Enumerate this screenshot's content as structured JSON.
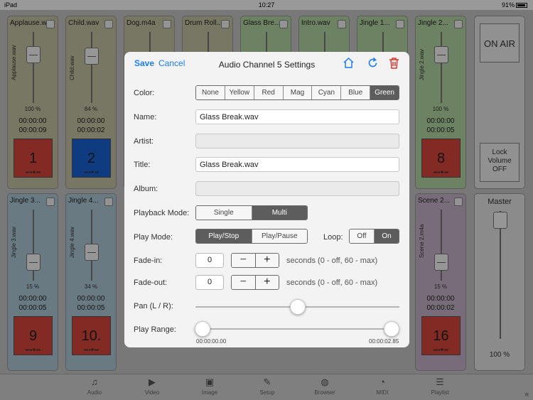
{
  "status": {
    "device": "iPad",
    "time": "10:27",
    "battery": "91%"
  },
  "channels_top": [
    {
      "name": "Applause.wav",
      "vname": "Applause.wav",
      "pct": "100 %",
      "t1": "00:00:00",
      "t2": "00:00:09",
      "num": "1",
      "color": "#d9473b",
      "bg": "#c9c7a5"
    },
    {
      "name": "Child.wav",
      "vname": "Child.wav",
      "pct": "84 %",
      "t1": "00:00:00",
      "t2": "00:00:02",
      "num": "2",
      "color": "#1a63d6",
      "bg": "#c9c7a5"
    },
    {
      "name": "Dog.m4a",
      "bg": "#c9c7a5"
    },
    {
      "name": "Drum Roll...",
      "bg": "#c9c7a5"
    },
    {
      "name": "Glass Bre...",
      "bg": "#b5d9a6"
    },
    {
      "name": "Intro.wav",
      "bg": "#b5d9a6"
    },
    {
      "name": "Jingle 1...",
      "bg": "#b5d9a6"
    },
    {
      "name": "Jingle 2...",
      "vname": "Jingle 2.wav",
      "pct": "100 %",
      "t1": "00:00:00",
      "t2": "00:00:05",
      "num": "8",
      "color": "#d9473b",
      "bg": "#b5d9a6"
    }
  ],
  "channels_bottom": [
    {
      "name": "Jingle 3...",
      "vname": "Jingle 3.wav",
      "pct": "15 %",
      "t1": "00:00:00",
      "t2": "00:00:05",
      "num": "9",
      "color": "#d9473b",
      "bg": "#b0ccd9"
    },
    {
      "name": "Jingle 4...",
      "vname": "Jingle 4.wav",
      "pct": "34 %",
      "t1": "00:00:00",
      "t2": "00:00:05",
      "num": "10.",
      "color": "#d9473b",
      "bg": "#b0ccd9"
    },
    {
      "name": "Scene 2...",
      "vname": "Scene 2.m4a",
      "pct": "15 %",
      "t1": "00:00:00",
      "t2": "00:00:02",
      "num": "16",
      "color": "#d9473b",
      "bg": "#c9b3cc"
    }
  ],
  "side": {
    "on_air": "ON AIR",
    "lock_l1": "Lock",
    "lock_l2": "Volume",
    "lock_l3": "OFF",
    "master": "Master",
    "master_pct": "100 %"
  },
  "tabs": [
    {
      "label": "Audio",
      "icon": "music-note-icon"
    },
    {
      "label": "Video",
      "icon": "video-camera-icon"
    },
    {
      "label": "Image",
      "icon": "image-icon"
    },
    {
      "label": "Setup",
      "icon": "pencil-icon"
    },
    {
      "label": "Browser",
      "icon": "globe-icon"
    },
    {
      "label": "MIDI",
      "icon": "midi-icon"
    },
    {
      "label": "Playlist",
      "icon": "list-icon"
    }
  ],
  "tab_corner": "R",
  "dialog": {
    "save": "Save",
    "cancel": "Cancel",
    "title": "Audio Channel 5 Settings",
    "color_label": "Color:",
    "colors": [
      "None",
      "Yellow",
      "Red",
      "Mag",
      "Cyan",
      "Blue",
      "Green"
    ],
    "color_selected": "Green",
    "name_label": "Name:",
    "name_value": "Glass Break.wav",
    "artist_label": "Artist:",
    "artist_value": "",
    "title_label": "Title:",
    "title_value": "Glass Break.wav",
    "album_label": "Album:",
    "album_value": "",
    "playback_label": "Playback Mode:",
    "playback_options": [
      "Single",
      "Multi"
    ],
    "playback_selected": "Multi",
    "playmode_label": "Play Mode:",
    "playmode_options": [
      "Play/Stop",
      "Play/Pause"
    ],
    "playmode_selected": "Play/Stop",
    "loop_label": "Loop:",
    "loop_options": [
      "Off",
      "On"
    ],
    "loop_selected": "On",
    "fadein_label": "Fade-in:",
    "fadein_value": "0",
    "fadeout_label": "Fade-out:",
    "fadeout_value": "0",
    "fade_hint": "seconds (0 - off, 60 - max)",
    "pan_label": "Pan (L / R):",
    "pan_value": 0.5,
    "range_label": "Play Range:",
    "range_start": "00:00:00.00",
    "range_end": "00:00:02.85"
  }
}
